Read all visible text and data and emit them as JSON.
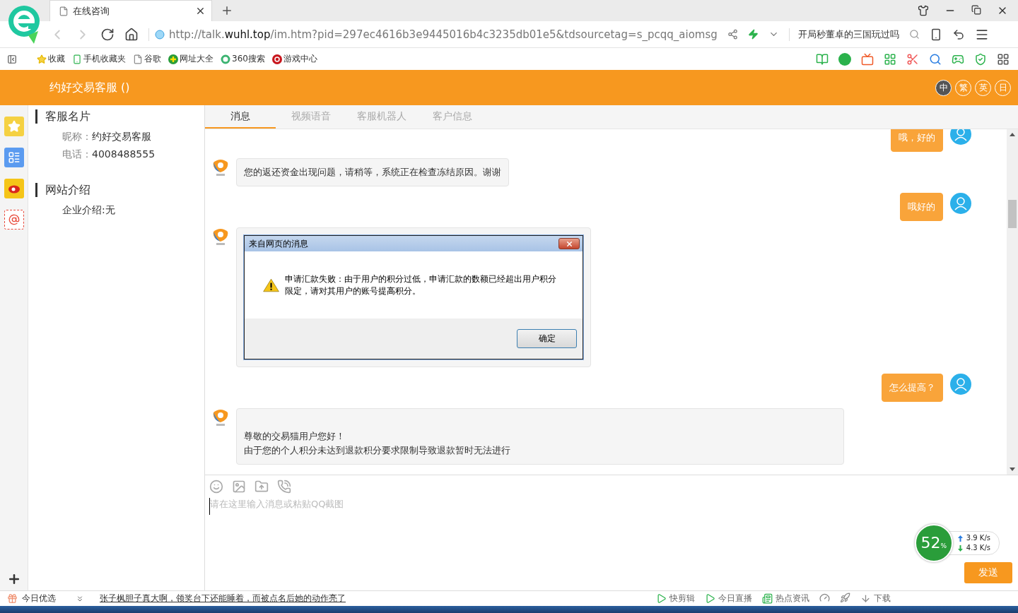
{
  "browser": {
    "tab_title": "在线咨询",
    "url": "http://talk.**wuhl.top**/im.htm?pid=297ec4616b3e9445016b4c3235db01e5&tdsourcetag=s_pcqq_aiomsg",
    "search_text": "开局秒董卓的三国玩过吗",
    "bookmarks": [
      {
        "label": "收藏",
        "kind": "star"
      },
      {
        "label": "手机收藏夹",
        "kind": "phone"
      },
      {
        "label": "谷歌",
        "kind": "page"
      },
      {
        "label": "网址大全",
        "kind": "plus"
      },
      {
        "label": "360搜索",
        "kind": "ring"
      },
      {
        "label": "游戏中心",
        "kind": "game"
      }
    ]
  },
  "header": {
    "title": "约好交易客服 ()",
    "languages": [
      {
        "label": "中",
        "selected": true
      },
      {
        "label": "繁",
        "selected": false
      },
      {
        "label": "英",
        "selected": false
      },
      {
        "label": "日",
        "selected": false
      }
    ]
  },
  "sidebar": [
    {
      "heading": "客服名片",
      "fields": [
        {
          "label": "昵称：",
          "value": "约好交易客服"
        },
        {
          "label": "电话：",
          "value": "4008488555"
        }
      ]
    },
    {
      "heading": "网站介绍",
      "fields": [
        {
          "value": "企业介绍:无"
        }
      ]
    }
  ],
  "chat_tabs": [
    {
      "label": "消息",
      "selected": true
    },
    {
      "label": "视频语音",
      "selected": false
    },
    {
      "label": "客服机器人",
      "selected": false
    },
    {
      "label": "客户信息",
      "selected": false
    }
  ],
  "messages": [
    {
      "kind": "sent",
      "lines": [
        "哦，好的"
      ]
    },
    {
      "kind": "received",
      "lines": [
        "您的返还资金出现问题，请稍等，系统正在检查冻结原因。谢谢"
      ]
    },
    {
      "kind": "sent",
      "lines": [
        "哦好的"
      ]
    },
    {
      "kind": "alert",
      "dialog": {
        "title": "来自网页的消息",
        "message": "申请汇款失败：由于用户的积分过低，申请汇款的数额已经超出用户积分限定，请对其用户的账号提高积分。",
        "button": "确定"
      }
    },
    {
      "kind": "sent",
      "lines": [
        "怎么提高？"
      ]
    },
    {
      "kind": "notice",
      "lines": [
        "尊敬的交易猫用户您好！",
        "由于您的个人积分未达到退款积分要求限制导致退款暂时无法进行"
      ]
    }
  ],
  "composer": {
    "placeholder": "请在这里输入消息或粘贴QQ截图",
    "send": "发送"
  },
  "net_meter": {
    "percent": "52",
    "unit": "%",
    "up": "3.9 K/s",
    "down": "4.3 K/s"
  },
  "footer": {
    "label": "今日优选",
    "headline": "张子枫胆子真大啊，领奖台下还能睡着，而被点名后她的动作亮了",
    "items": [
      {
        "label": "快剪辑",
        "kind": "clip"
      },
      {
        "label": "今日直播",
        "kind": "live"
      },
      {
        "label": "热点资讯",
        "kind": "news"
      },
      {
        "label": "下载",
        "kind": "download"
      }
    ]
  }
}
